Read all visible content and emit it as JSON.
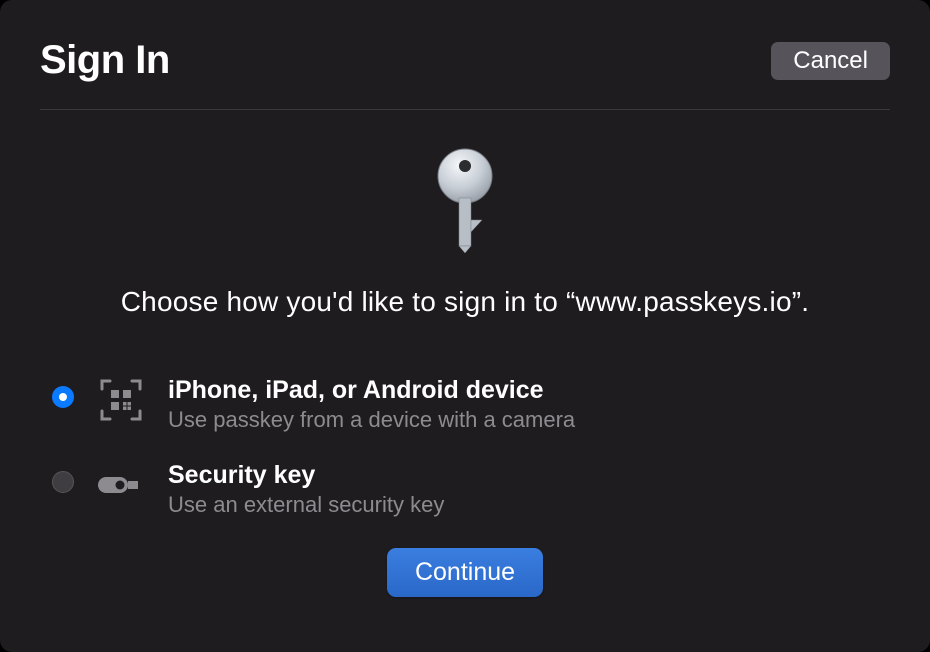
{
  "header": {
    "title": "Sign In",
    "cancel_label": "Cancel"
  },
  "prompt": "Choose how you'd like to sign in to “www.passkeys.io”.",
  "options": [
    {
      "title": "iPhone, iPad, or Android device",
      "desc": "Use passkey from a device with a camera",
      "selected": true
    },
    {
      "title": "Security key",
      "desc": "Use an external security key",
      "selected": false
    }
  ],
  "footer": {
    "continue_label": "Continue"
  }
}
